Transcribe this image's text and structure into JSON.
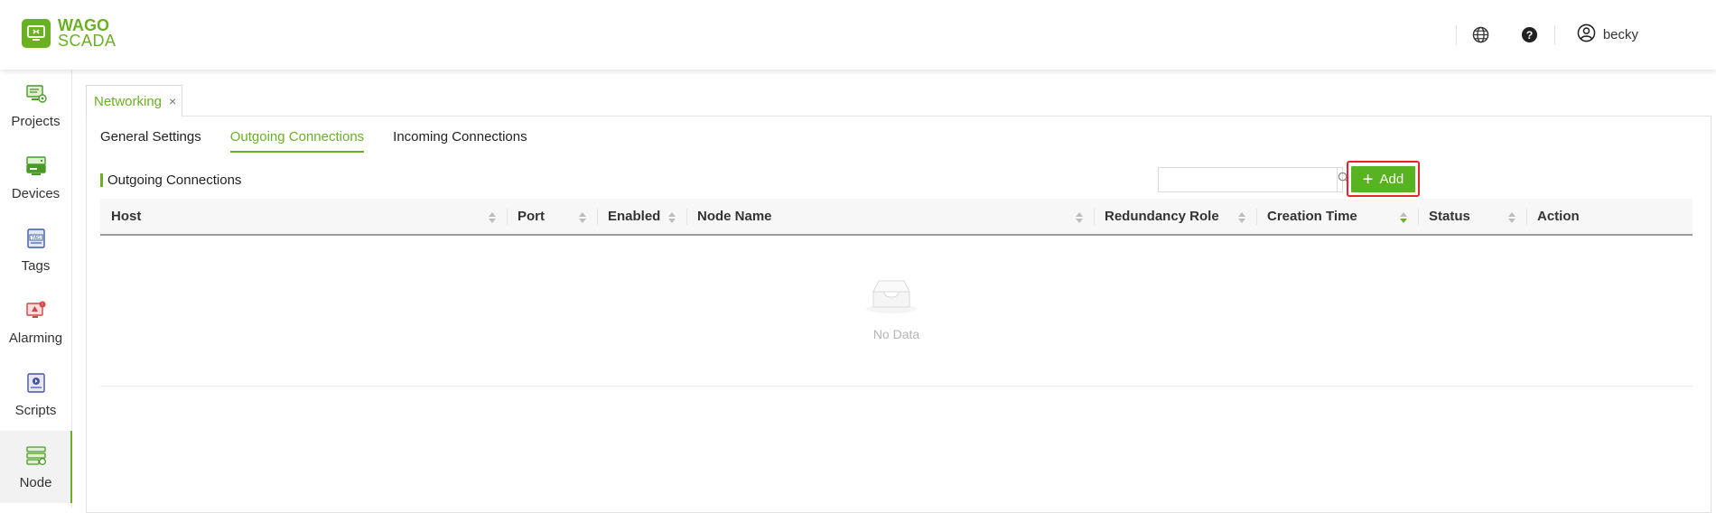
{
  "brand": {
    "line1": "WAGO",
    "line2": "SCADA",
    "color": "#6ab023"
  },
  "header": {
    "icons": [
      "globe-icon",
      "help-icon"
    ],
    "user": {
      "name": "becky",
      "icon": "user-circle-icon"
    }
  },
  "sidebar": {
    "items": [
      {
        "label": "Projects",
        "icon": "projects-icon",
        "active": false
      },
      {
        "label": "Devices",
        "icon": "devices-icon",
        "active": false
      },
      {
        "label": "Tags",
        "icon": "tags-icon",
        "active": false
      },
      {
        "label": "Alarming",
        "icon": "alarming-icon",
        "active": false
      },
      {
        "label": "Scripts",
        "icon": "scripts-icon",
        "active": false
      },
      {
        "label": "Node",
        "icon": "node-icon",
        "active": true
      }
    ]
  },
  "page_tab": {
    "label": "Networking",
    "close": "×"
  },
  "subtabs": [
    {
      "label": "General Settings",
      "active": false
    },
    {
      "label": "Outgoing Connections",
      "active": true
    },
    {
      "label": "Incoming Connections",
      "active": false
    }
  ],
  "section": {
    "title": "Outgoing Connections"
  },
  "search": {
    "placeholder": "",
    "value": ""
  },
  "add_button": {
    "label": "Add",
    "highlighted": true,
    "highlight_color": "#e3262a"
  },
  "table": {
    "columns": [
      {
        "label": "Host",
        "sortable": true,
        "sort": "none"
      },
      {
        "label": "Port",
        "sortable": true,
        "sort": "none"
      },
      {
        "label": "Enabled",
        "sortable": true,
        "sort": "none"
      },
      {
        "label": "Node Name",
        "sortable": true,
        "sort": "none"
      },
      {
        "label": "Redundancy Role",
        "sortable": true,
        "sort": "none"
      },
      {
        "label": "Creation Time",
        "sortable": true,
        "sort": "descending"
      },
      {
        "label": "Status",
        "sortable": true,
        "sort": "none"
      },
      {
        "label": "Action",
        "sortable": false,
        "sort": "none"
      }
    ],
    "rows": [],
    "empty_text": "No Data"
  }
}
